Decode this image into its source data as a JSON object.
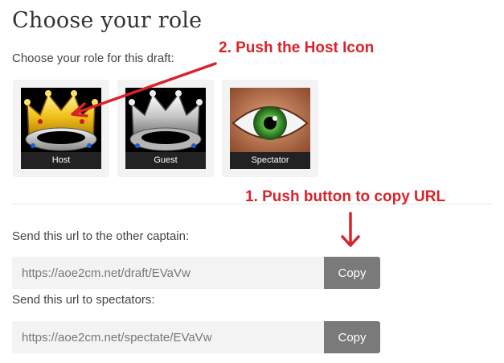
{
  "page": {
    "title": "Choose your role",
    "subtitle": "Choose your role for this draft:"
  },
  "roles": [
    {
      "label": "Host",
      "icon": "gold-crown-icon"
    },
    {
      "label": "Guest",
      "icon": "silver-crown-icon"
    },
    {
      "label": "Spectator",
      "icon": "eye-icon"
    }
  ],
  "captain_url": {
    "label": "Send this url to the other captain:",
    "value": "https://aoe2cm.net/draft/EVaVw",
    "copy_label": "Copy"
  },
  "spectator_url": {
    "label": "Send this url to spectators:",
    "value": "https://aoe2cm.net/spectate/EVaVw",
    "copy_label": "Copy"
  },
  "annotations": {
    "step2": "2.  Push the Host Icon",
    "step1": "1. Push button to copy URL"
  },
  "colors": {
    "annotation": "#d8232a",
    "button": "#7a7a7a",
    "card": "#f3f3f3",
    "input": "#f3f3f3"
  }
}
